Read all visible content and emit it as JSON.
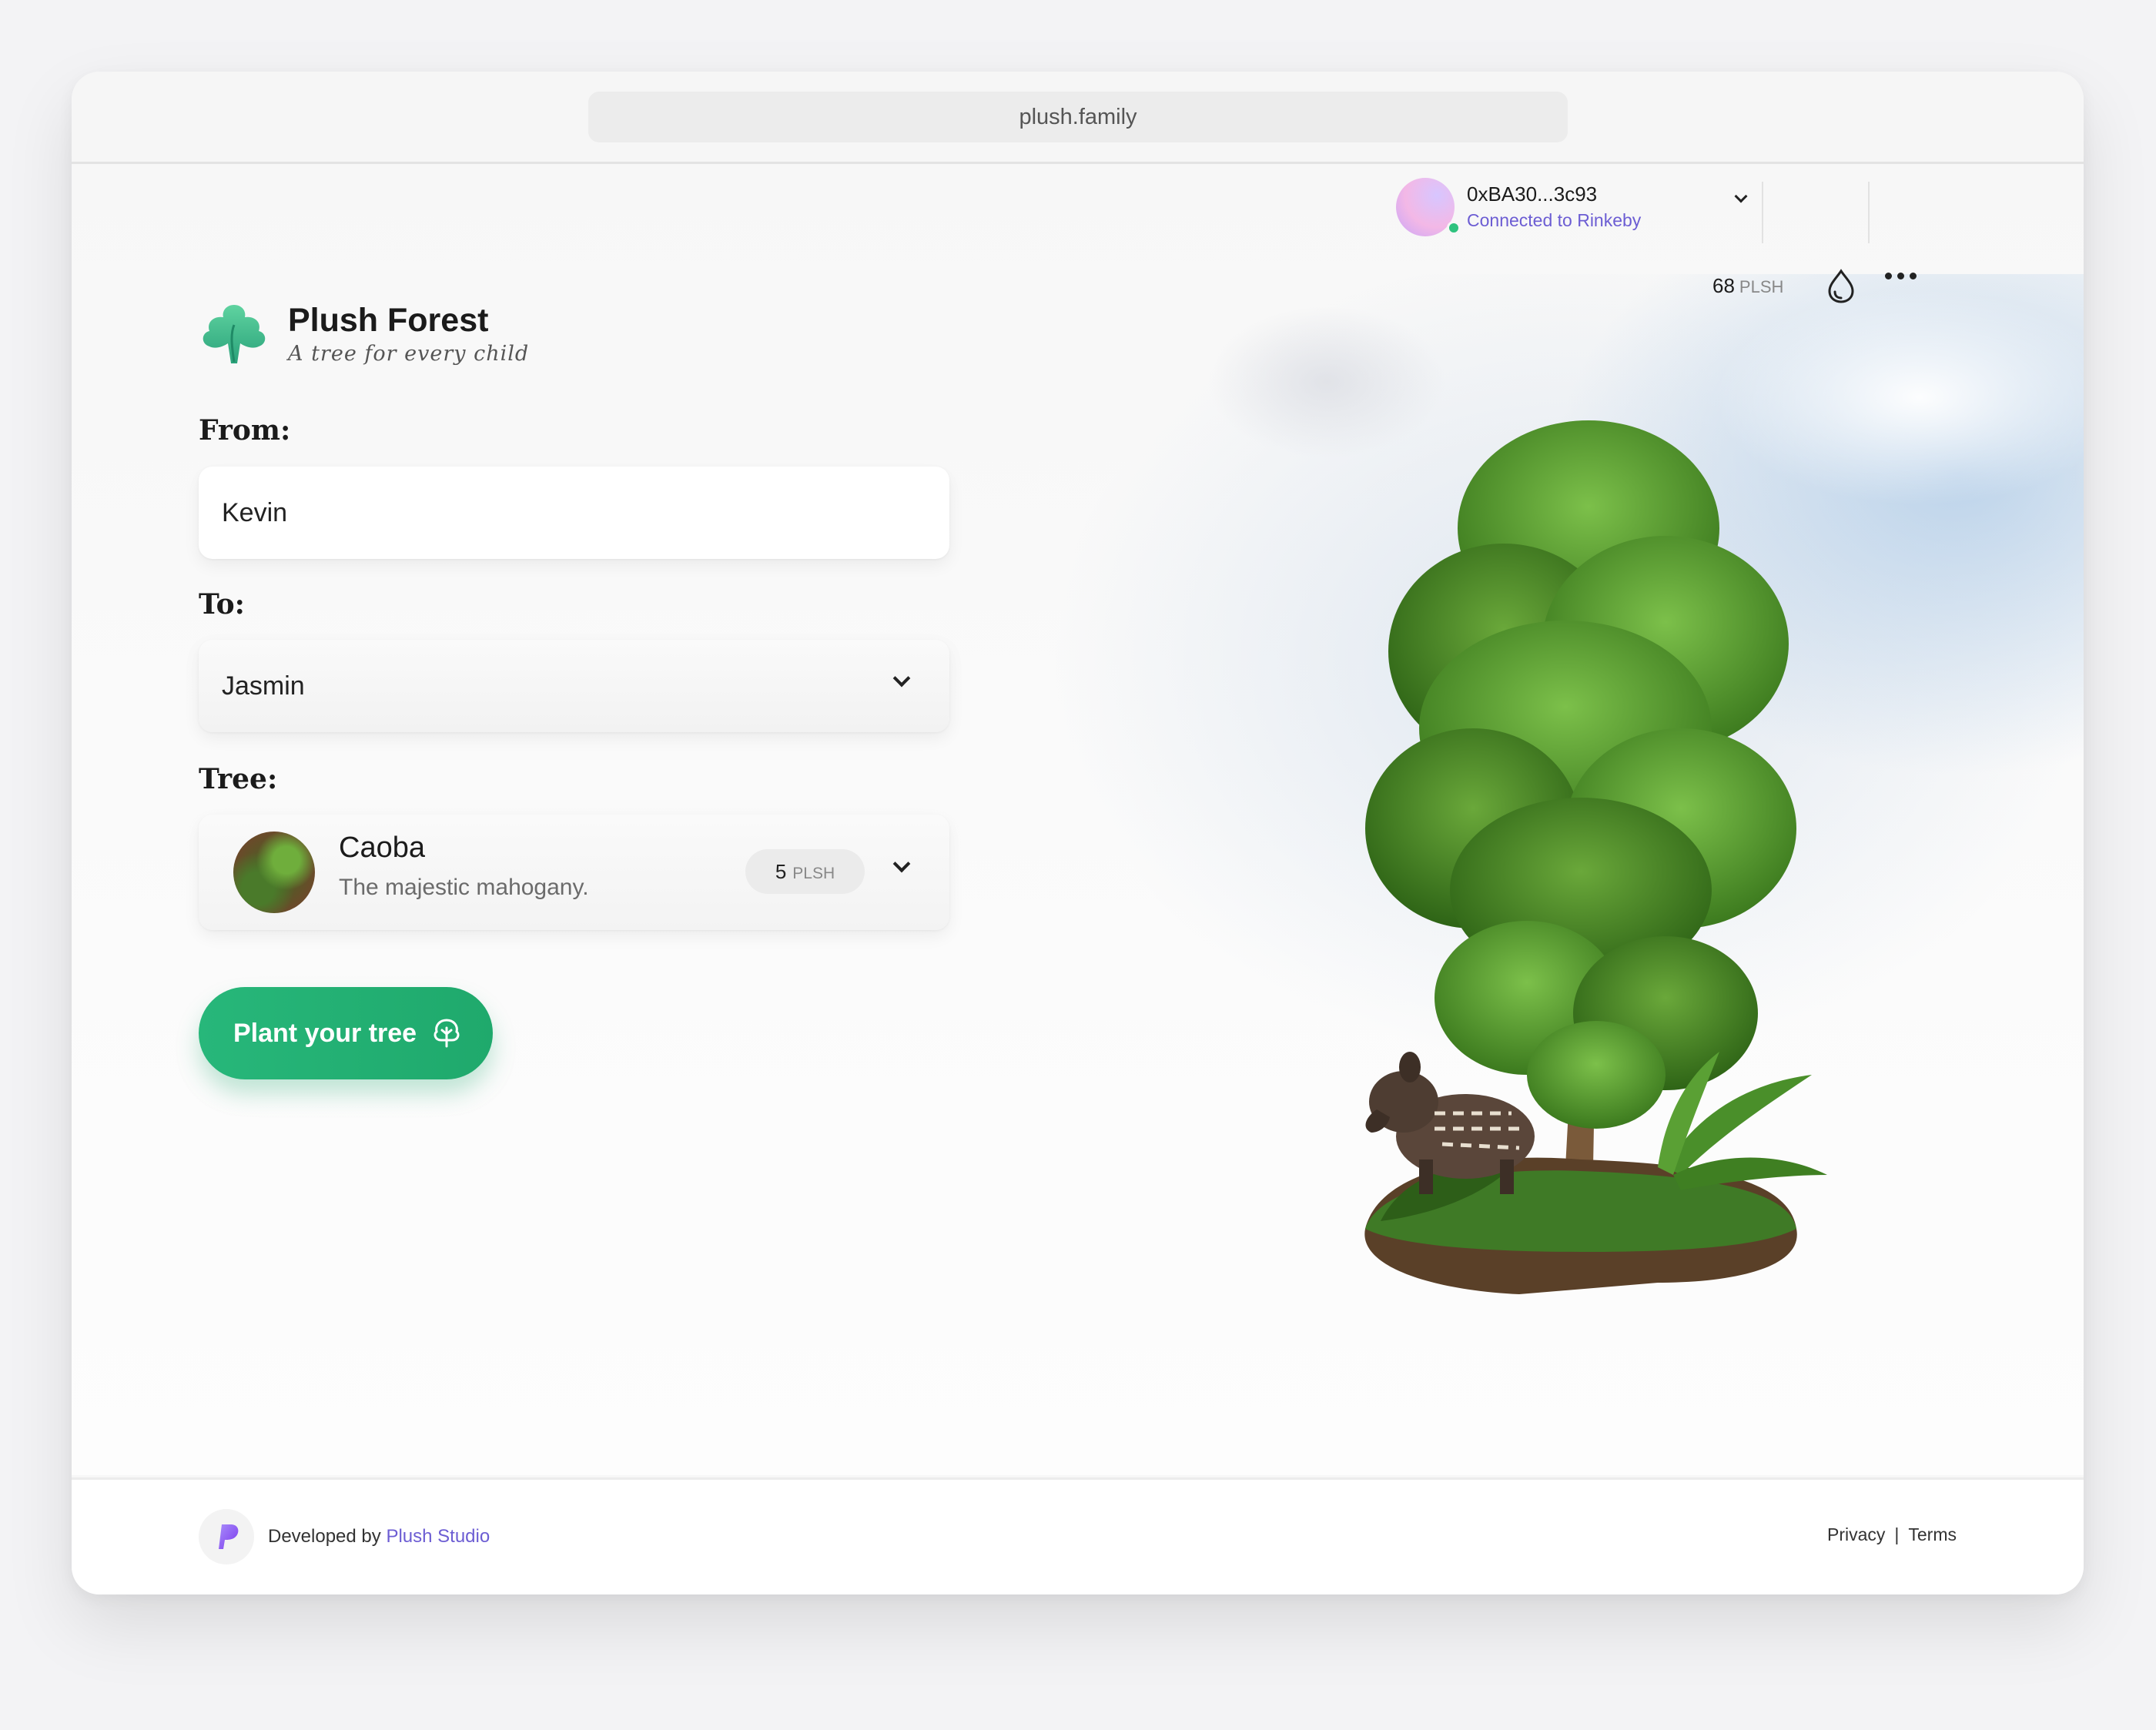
{
  "browser": {
    "url": "plush.family"
  },
  "brand": {
    "title": "Plush Forest",
    "tagline": "A tree for every child"
  },
  "header": {
    "wallet_address": "0xBA30...3c93",
    "network_status": "Connected to Rinkeby",
    "balance_value": "68",
    "balance_unit": "PLSH",
    "icons": [
      "drop-icon",
      "more-icon"
    ]
  },
  "form": {
    "from_label": "From:",
    "from_value": "Kevin",
    "to_label": "To:",
    "to_value": "Jasmin",
    "tree_label": "Tree:",
    "tree": {
      "name": "Caoba",
      "description": "The majestic mahogany.",
      "price_value": "5",
      "price_unit": "PLSH"
    },
    "submit_label": "Plant your tree"
  },
  "footer": {
    "developed_by": "Developed by",
    "studio_name": "Plush Studio",
    "privacy": "Privacy",
    "separator": "|",
    "terms": "Terms"
  },
  "colors": {
    "accent_green": "#22b072",
    "link_purple": "#6c5dd3"
  }
}
